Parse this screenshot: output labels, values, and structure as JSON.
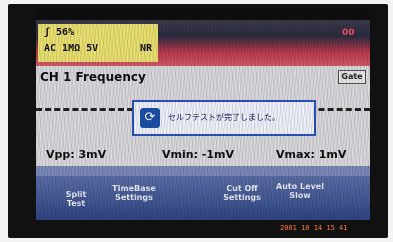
{
  "channel": {
    "line1": "ʃ   56%",
    "coupling": "AC 1MΩ  5V",
    "filter": "NR"
  },
  "indicator": "00",
  "measurement": {
    "title": "CH 1 Frequency",
    "gate_label": "Gate"
  },
  "dialog": {
    "icon": "self-test-icon",
    "message": "セルフテストが完了しました。"
  },
  "readouts": {
    "vpp": "Vpp:  3mV",
    "vmin": "Vmin: -1mV",
    "vmax": "Vmax:  1mV"
  },
  "softkeys": {
    "split_test": "Split\nTest",
    "timebase": "TimeBase\nSettings",
    "cutoff": "Cut Off\nSettings",
    "auto_level": "Auto Level\nSlow"
  },
  "timestamp": "2001 10 14  15 41",
  "colors": {
    "channel_box": "#e9e070",
    "dialog_border": "#2a52be",
    "softkey_bar": "#2f4584",
    "timestamp": "#ff7a30"
  }
}
